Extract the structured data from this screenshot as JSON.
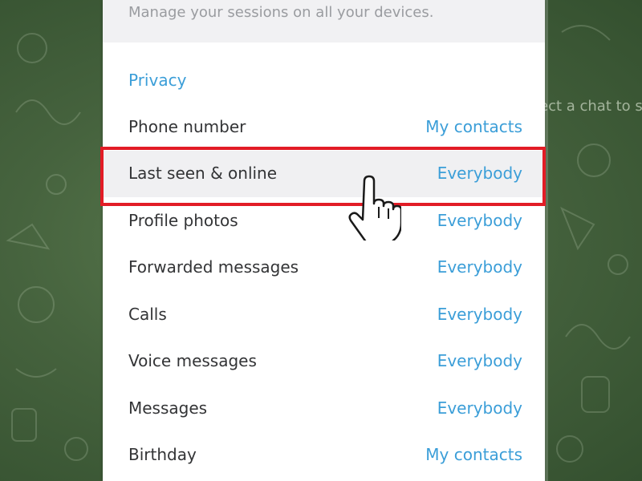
{
  "background": {
    "hint_text": "ect a chat to s"
  },
  "sessions": {
    "description": "Manage your sessions on all your devices."
  },
  "privacy": {
    "title": "Privacy",
    "rows": [
      {
        "label": "Phone number",
        "value": "My contacts"
      },
      {
        "label": "Last seen & online",
        "value": "Everybody"
      },
      {
        "label": "Profile photos",
        "value": "Everybody"
      },
      {
        "label": "Forwarded messages",
        "value": "Everybody"
      },
      {
        "label": "Calls",
        "value": "Everybody"
      },
      {
        "label": "Voice messages",
        "value": "Everybody"
      },
      {
        "label": "Messages",
        "value": "Everybody"
      },
      {
        "label": "Birthday",
        "value": "My contacts"
      }
    ]
  },
  "colors": {
    "accent": "#3b9ed8",
    "highlight": "#e21c26",
    "background": "#46633e"
  },
  "icons": {
    "cursor": "hand-pointer-icon"
  }
}
